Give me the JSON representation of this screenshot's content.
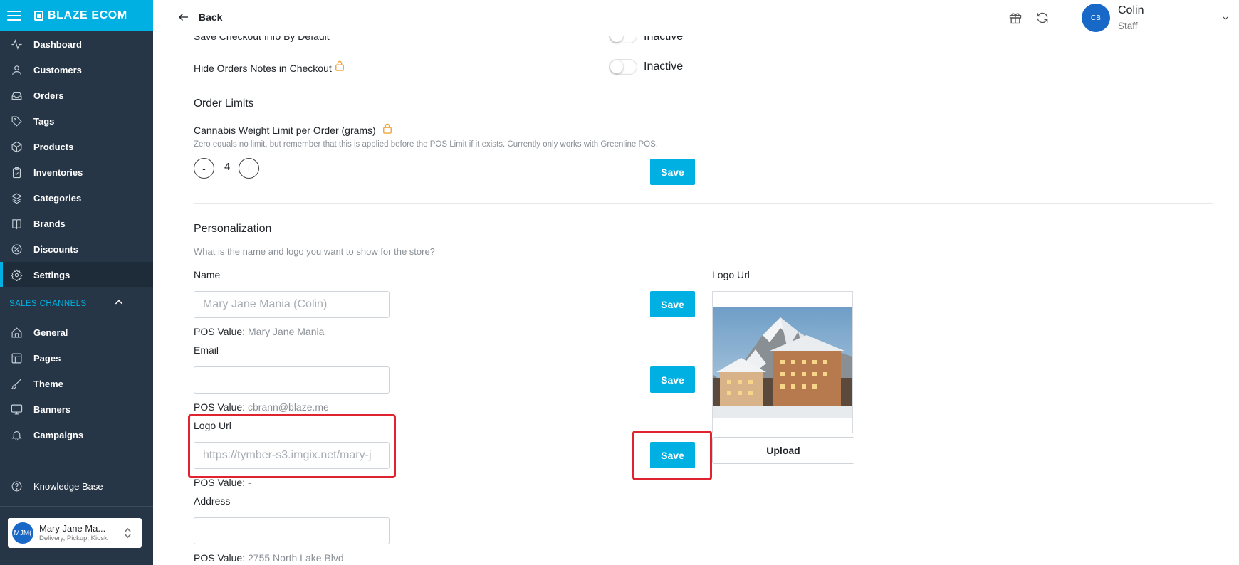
{
  "app": {
    "brand": "BLAZE ECOM"
  },
  "sidebar": {
    "items": [
      {
        "label": "Dashboard",
        "icon": "activity-icon"
      },
      {
        "label": "Customers",
        "icon": "user-icon"
      },
      {
        "label": "Orders",
        "icon": "inbox-icon"
      },
      {
        "label": "Tags",
        "icon": "tag-icon"
      },
      {
        "label": "Products",
        "icon": "box-icon"
      },
      {
        "label": "Inventories",
        "icon": "clipboard-icon"
      },
      {
        "label": "Categories",
        "icon": "layers-icon"
      },
      {
        "label": "Brands",
        "icon": "book-icon"
      },
      {
        "label": "Discounts",
        "icon": "percent-icon"
      },
      {
        "label": "Settings",
        "icon": "gear-icon",
        "active": true
      }
    ],
    "sales_channels_label": "SALES CHANNELS",
    "channels": [
      {
        "label": "General",
        "icon": "home-icon"
      },
      {
        "label": "Pages",
        "icon": "layout-icon"
      },
      {
        "label": "Theme",
        "icon": "brush-icon"
      },
      {
        "label": "Banners",
        "icon": "monitor-icon"
      },
      {
        "label": "Campaigns",
        "icon": "bell-icon"
      }
    ],
    "knowledge_base": "Knowledge Base",
    "store": {
      "initials": "MJM(",
      "name": "Mary Jane Ma...",
      "subtitle": "Delivery, Pickup, Kiosk"
    }
  },
  "topbar": {
    "back_label": "Back",
    "user": {
      "initials": "CB",
      "name": "Colin",
      "role": "Staff"
    }
  },
  "settings": {
    "save_checkout": {
      "label": "Save Checkout Info By Default",
      "status": "Inactive"
    },
    "hide_notes": {
      "label": "Hide Orders Notes in Checkout",
      "status": "Inactive"
    }
  },
  "order_limits": {
    "title": "Order Limits",
    "weight_label": "Cannabis Weight Limit per Order (grams)",
    "helper": "Zero equals no limit, but remember that this is applied before the POS Limit if it exists. Currently only works with Greenline POS.",
    "minus": "-",
    "plus": "+",
    "value": "4",
    "save": "Save"
  },
  "personalization": {
    "title": "Personalization",
    "subtitle": "What is the name and logo you want to show for the store?",
    "pos_prefix": "POS Value:",
    "name": {
      "label": "Name",
      "placeholder": "Mary Jane Mania (Colin)",
      "pos_value": "Mary Jane Mania",
      "save": "Save"
    },
    "email": {
      "label": "Email",
      "placeholder": "",
      "pos_value": "cbrann@blaze.me",
      "save": "Save"
    },
    "logo_url": {
      "label": "Logo Url",
      "placeholder": "https://tymber-s3.imgix.net/mary-j",
      "pos_value": "-",
      "save": "Save"
    },
    "address": {
      "label": "Address",
      "placeholder": "",
      "pos_value": "2755 North Lake Blvd"
    },
    "logo_preview": {
      "label": "Logo Url",
      "upload": "Upload"
    }
  },
  "colors": {
    "accent": "#00b0e3",
    "sidebar": "#263646",
    "highlight": "#e0242f",
    "lock": "#f0a63c"
  }
}
